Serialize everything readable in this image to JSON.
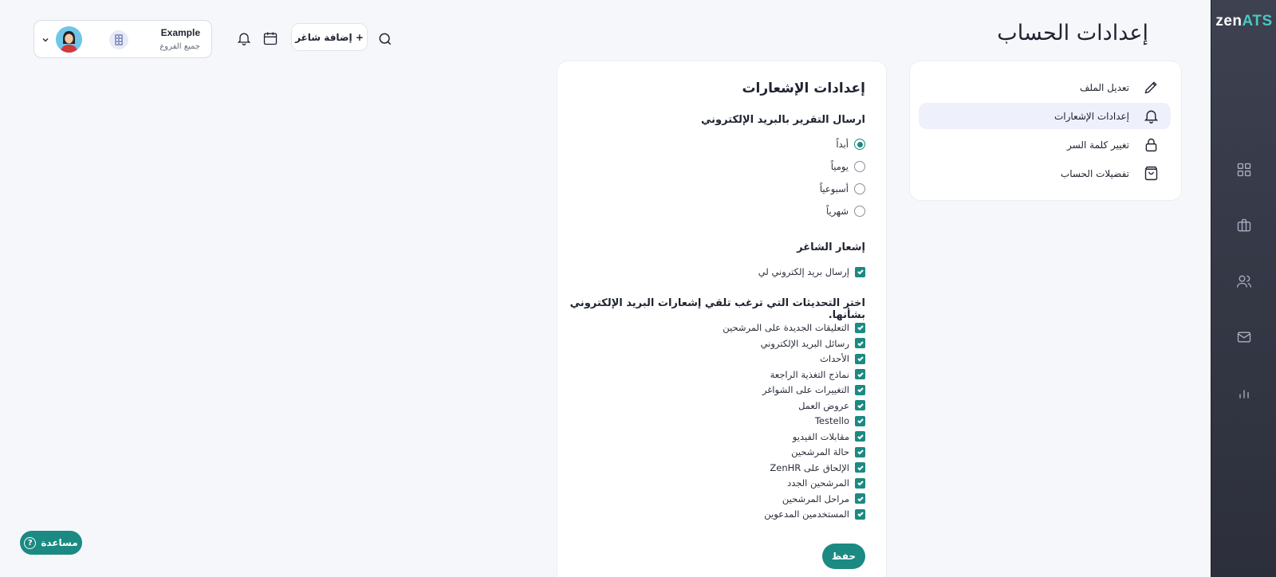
{
  "brand": {
    "logo_main": "zen",
    "logo_accent": "ATS",
    "accent_color": "#1a8a82"
  },
  "page_title": "إعدادات الحساب",
  "topbar": {
    "user_name": "Example",
    "branch": "جميع الفروع",
    "add_button": "+ إضافة شاغر"
  },
  "settings_nav": {
    "items": [
      {
        "label": "تعديل الملف",
        "icon": "pencil-icon"
      },
      {
        "label": "إعدادات الإشعارات",
        "icon": "bell-icon"
      },
      {
        "label": "تغيير كلمة السر",
        "icon": "lock-icon"
      },
      {
        "label": "تفضيلات الحساب",
        "icon": "bag-icon"
      }
    ],
    "active_item": "إعدادات الإشعارات"
  },
  "notifications": {
    "title": "إعدادات الإشعارات",
    "email_report": {
      "title": "ارسال التقرير بالبريد الإلكتروني",
      "options": [
        "أبداً",
        "يومياً",
        "أسبوعياً",
        "شهرياً"
      ],
      "selected": "أبداً"
    },
    "vacancy_notice": {
      "title": "إشعار الشاغر",
      "option": "إرسال بريد إلكتروني لي"
    },
    "updates": {
      "title": "اختر التحديثات التي ترغب تلقي إشعارات البريد الإلكتروني بشأنها.",
      "items": [
        "التعليقات الجديدة على المرشحين",
        "رسائل البريد الإلكتروني",
        "الأحداث",
        "نماذج التغذية الراجعة",
        "التغييرات على الشواغر",
        "عروض العمل",
        "Testello",
        "مقابلات الفيديو",
        "حالة المرشحين",
        "الإلحاق على ZenHR",
        "المرشحين الجدد",
        "مراحل المرشحين",
        "المستخدمين المدعوين"
      ]
    },
    "save_label": "حفظ"
  },
  "help_label": "مساعدة",
  "rail_icons": [
    "dashboard-icon",
    "briefcase-icon",
    "users-icon",
    "mail-icon",
    "bar-chart-icon"
  ]
}
